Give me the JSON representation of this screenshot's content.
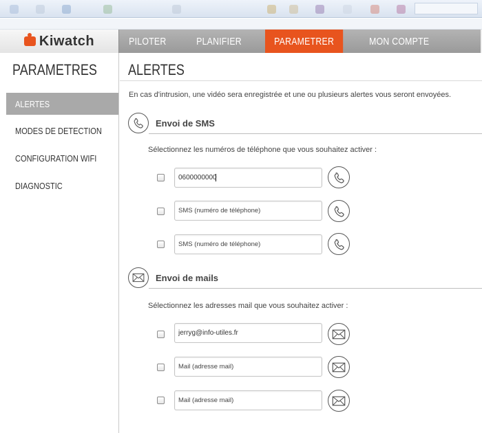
{
  "app": {
    "logo_text": "Kiwatch"
  },
  "nav": {
    "tabs": [
      {
        "label": "PILOTER",
        "active": false
      },
      {
        "label": "PLANIFIER",
        "active": false
      },
      {
        "label": "PARAMETRER",
        "active": true
      },
      {
        "label": "MON COMPTE",
        "active": false
      }
    ]
  },
  "sidebar": {
    "title": "PARAMETRES",
    "items": [
      {
        "label": "ALERTES",
        "active": true
      },
      {
        "label": "MODES DE DETECTION",
        "active": false
      },
      {
        "label": "CONFIGURATION WIFI",
        "active": false
      },
      {
        "label": "DIAGNOSTIC",
        "active": false
      }
    ]
  },
  "main": {
    "title": "ALERTES",
    "intro": "En cas d'intrusion, une vidéo sera enregistrée et une ou plusieurs alertes vous seront envoyées.",
    "sms": {
      "section_label": "Envoi de SMS",
      "icon": "phone-icon",
      "instruction": "Sélectionnez les numéros de téléphone que vous souhaitez activer :",
      "rows": [
        {
          "value": "0600000000",
          "placeholder": "SMS (numéro de téléphone)",
          "checked": false
        },
        {
          "value": "",
          "placeholder": "SMS (numéro de téléphone)",
          "checked": false
        },
        {
          "value": "",
          "placeholder": "SMS (numéro de téléphone)",
          "checked": false
        }
      ]
    },
    "mail": {
      "section_label": "Envoi de mails",
      "icon": "envelope-icon",
      "instruction": "Sélectionnez les adresses mail que vous souhaitez activer :",
      "rows": [
        {
          "value": "jerryg@info-utiles.fr",
          "placeholder": "Mail (adresse mail)",
          "checked": false
        },
        {
          "value": "",
          "placeholder": "Mail (adresse mail)",
          "checked": false
        },
        {
          "value": "",
          "placeholder": "Mail (adresse mail)",
          "checked": false
        }
      ]
    }
  },
  "colors": {
    "accent": "#e8541e",
    "nav_bg": "#a6a6a6",
    "sidebar_active_bg": "#a9a9a9",
    "icon_stroke": "#555555"
  }
}
